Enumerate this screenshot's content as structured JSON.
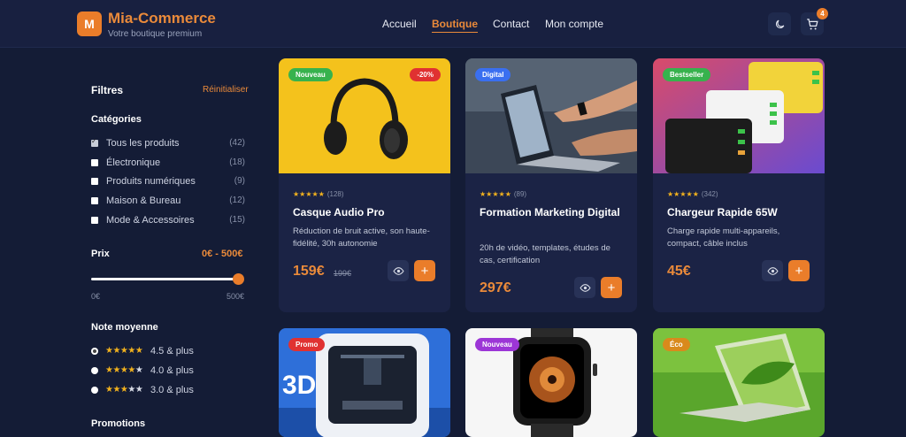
{
  "header": {
    "logo_letter": "M",
    "brand": "Mia-Commerce",
    "tagline": "Votre boutique premium",
    "nav": [
      "Accueil",
      "Boutique",
      "Contact",
      "Mon compte"
    ],
    "active_nav": "Boutique",
    "cart_count": "4"
  },
  "sidebar": {
    "title": "Filtres",
    "reset": "Réinitialiser",
    "categories_title": "Catégories",
    "categories": [
      {
        "label": "Tous les produits",
        "count": "(42)",
        "checked": true
      },
      {
        "label": "Électronique",
        "count": "(18)",
        "checked": false
      },
      {
        "label": "Produits numériques",
        "count": "(9)",
        "checked": false
      },
      {
        "label": "Maison & Bureau",
        "count": "(12)",
        "checked": false
      },
      {
        "label": "Mode & Accessoires",
        "count": "(15)",
        "checked": false
      }
    ],
    "price_title": "Prix",
    "price_range": "0€ - 500€",
    "price_min": "0€",
    "price_max": "500€",
    "price_slider_fraction": 1.0,
    "rating_title": "Note moyenne",
    "ratings": [
      {
        "stars": 5,
        "label": "4.5 & plus",
        "selected": true
      },
      {
        "stars": 4,
        "label": "4.0 & plus",
        "selected": false
      },
      {
        "stars": 3,
        "label": "3.0 & plus",
        "selected": false
      }
    ],
    "promotions_title": "Promotions"
  },
  "products": [
    {
      "badge": "Nouveau",
      "badge_color": "#37b24d",
      "discount": "-20%",
      "reviews": "(128)",
      "title": "Casque Audio Pro",
      "desc": "Réduction de bruit active, son haute-fidélité, 30h autonomie",
      "price": "159€",
      "old_price": "199€",
      "image": "headphones"
    },
    {
      "badge": "Digital",
      "badge_color": "#3a6ff0",
      "reviews": "(89)",
      "title": "Formation Marketing Digital",
      "desc": "20h de vidéo, templates, études de cas, certification",
      "price": "297€",
      "image": "laptop"
    },
    {
      "badge": "Bestseller",
      "badge_color": "#37b24d",
      "reviews": "(342)",
      "title": "Chargeur Rapide 65W",
      "desc": "Charge rapide multi-appareils, compact, câble inclus",
      "price": "45€",
      "image": "chargers"
    },
    {
      "badge": "Promo",
      "badge_color": "#e03131",
      "image": "3d-printer"
    },
    {
      "badge": "Nouveau",
      "badge_color": "#9c36d6",
      "image": "smartwatch"
    },
    {
      "badge": "Éco",
      "badge_color": "#d98a1c",
      "image": "eco-laptop"
    }
  ],
  "stars_glyph": "★★★★★",
  "colors": {
    "accent": "#ea7d2a",
    "background": "#141c36",
    "card": "#1b2345"
  }
}
